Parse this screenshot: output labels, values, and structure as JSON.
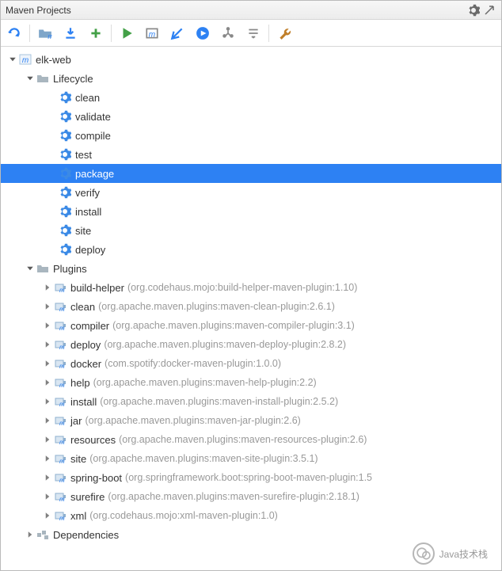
{
  "header": {
    "title": "Maven Projects"
  },
  "tree": {
    "root": {
      "label": "elk-web",
      "lifecycle_label": "Lifecycle",
      "plugins_label": "Plugins",
      "dependencies_label": "Dependencies",
      "goals": [
        {
          "label": "clean"
        },
        {
          "label": "validate"
        },
        {
          "label": "compile"
        },
        {
          "label": "test"
        },
        {
          "label": "package",
          "selected": true
        },
        {
          "label": "verify"
        },
        {
          "label": "install"
        },
        {
          "label": "site"
        },
        {
          "label": "deploy"
        }
      ],
      "plugins": [
        {
          "name": "build-helper",
          "detail": "(org.codehaus.mojo:build-helper-maven-plugin:1.10)"
        },
        {
          "name": "clean",
          "detail": "(org.apache.maven.plugins:maven-clean-plugin:2.6.1)"
        },
        {
          "name": "compiler",
          "detail": "(org.apache.maven.plugins:maven-compiler-plugin:3.1)"
        },
        {
          "name": "deploy",
          "detail": "(org.apache.maven.plugins:maven-deploy-plugin:2.8.2)"
        },
        {
          "name": "docker",
          "detail": "(com.spotify:docker-maven-plugin:1.0.0)"
        },
        {
          "name": "help",
          "detail": "(org.apache.maven.plugins:maven-help-plugin:2.2)"
        },
        {
          "name": "install",
          "detail": "(org.apache.maven.plugins:maven-install-plugin:2.5.2)"
        },
        {
          "name": "jar",
          "detail": "(org.apache.maven.plugins:maven-jar-plugin:2.6)"
        },
        {
          "name": "resources",
          "detail": "(org.apache.maven.plugins:maven-resources-plugin:2.6)"
        },
        {
          "name": "site",
          "detail": "(org.apache.maven.plugins:maven-site-plugin:3.5.1)"
        },
        {
          "name": "spring-boot",
          "detail": "(org.springframework.boot:spring-boot-maven-plugin:1.5"
        },
        {
          "name": "surefire",
          "detail": "(org.apache.maven.plugins:maven-surefire-plugin:2.18.1)"
        },
        {
          "name": "xml",
          "detail": "(org.codehaus.mojo:xml-maven-plugin:1.0)"
        }
      ]
    }
  },
  "watermark": "Java技术栈"
}
